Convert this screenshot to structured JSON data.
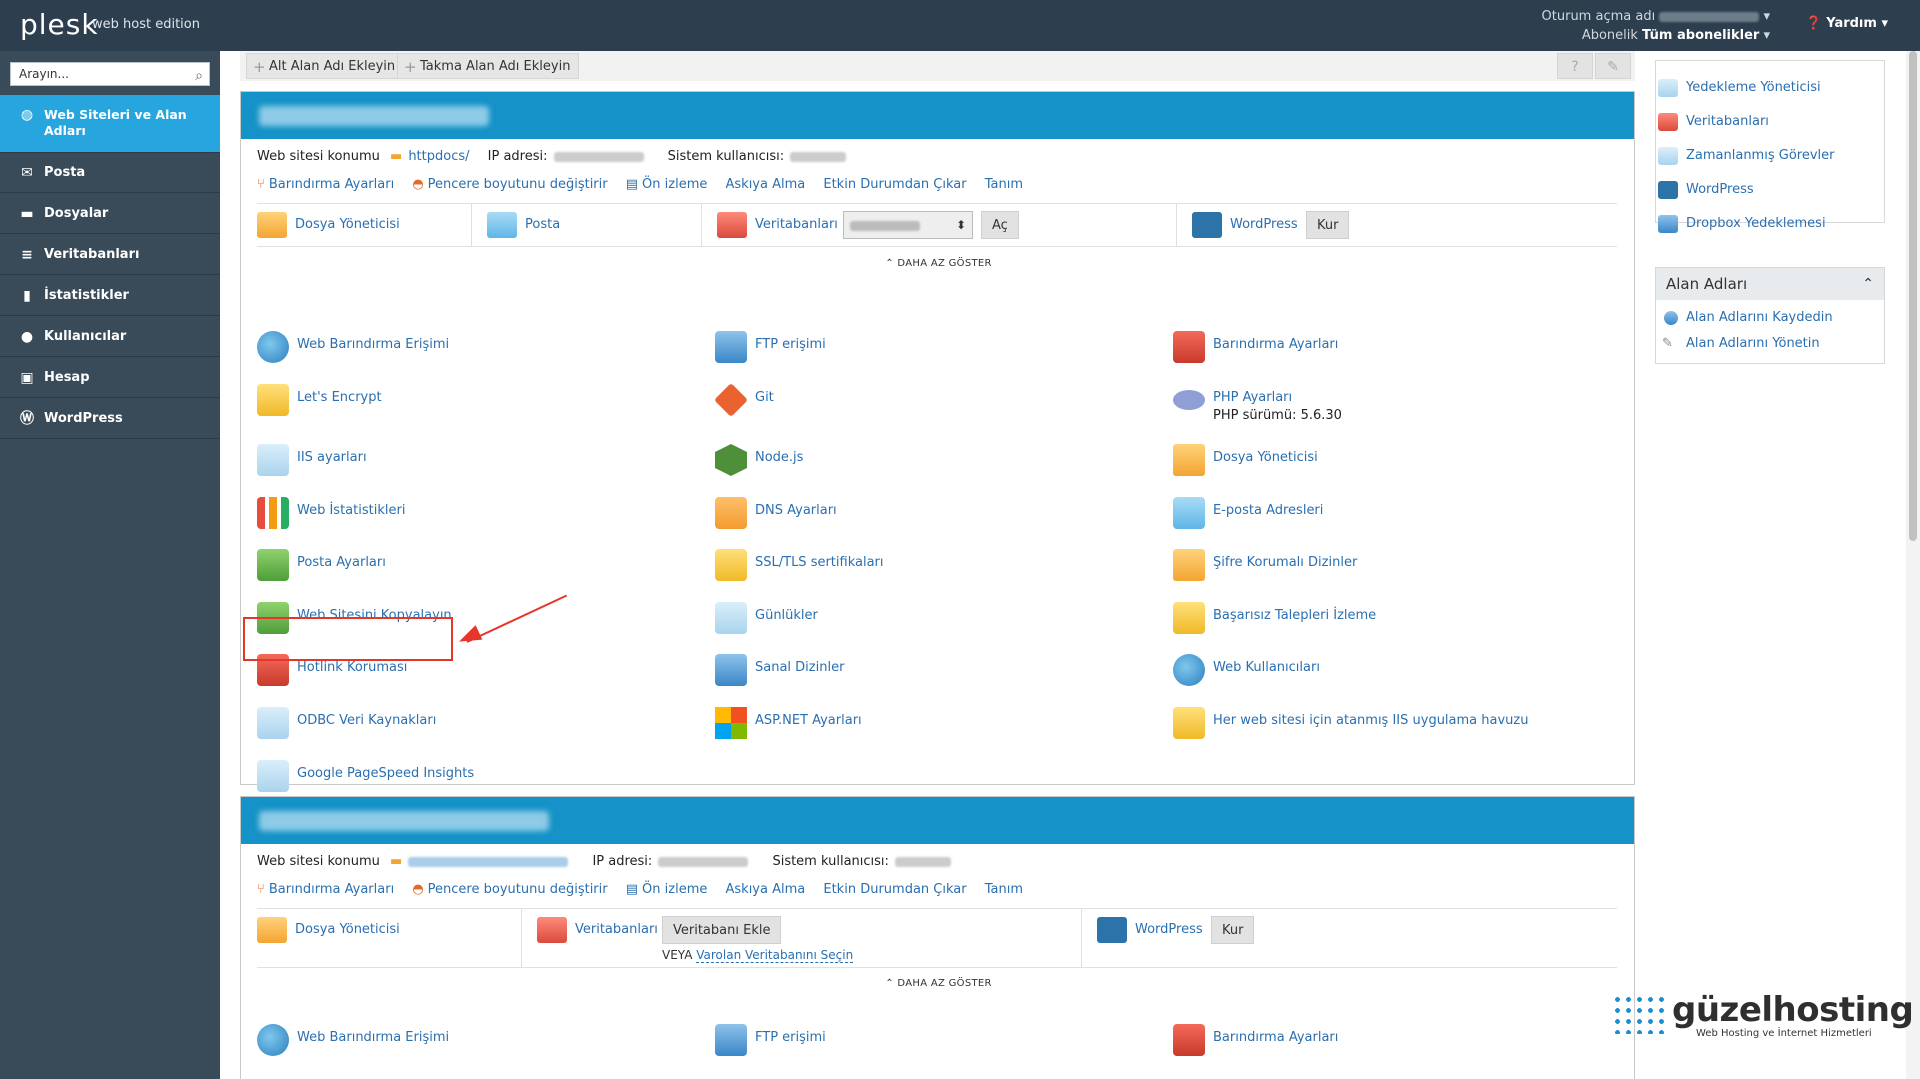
{
  "header": {
    "logo": "plesk",
    "edition": "web host edition",
    "login_label": "Oturum açma adı",
    "subscription_label": "Abonelik",
    "subscription_value": "Tüm abonelikler",
    "help": "Yardım"
  },
  "sidebar": {
    "search_placeholder": "Arayın...",
    "items": [
      {
        "label": "Web Siteleri ve Alan Adları",
        "icon": "globe-icon"
      },
      {
        "label": "Posta",
        "icon": "mail-icon"
      },
      {
        "label": "Dosyalar",
        "icon": "folder-icon"
      },
      {
        "label": "Veritabanları",
        "icon": "database-icon"
      },
      {
        "label": "İstatistikler",
        "icon": "stats-icon"
      },
      {
        "label": "Kullanıcılar",
        "icon": "user-icon"
      },
      {
        "label": "Hesap",
        "icon": "account-icon"
      },
      {
        "label": "WordPress",
        "icon": "wordpress-icon"
      }
    ]
  },
  "toolbar": {
    "add_subdomain": "Alt Alan Adı Ekleyin",
    "add_alias": "Takma Alan Adı Ekleyin"
  },
  "sub1": {
    "site_location_label": "Web sitesi konumu",
    "site_location_value": "httpdocs/",
    "ip_label": "IP adresi:",
    "sysuser_label": "Sistem kullanıcısı:",
    "links": [
      "Barındırma Ayarları",
      "Pencere boyutunu değiştirir",
      "Ön izleme",
      "Askıya Alma",
      "Etkin Durumdan Çıkar",
      "Tanım"
    ],
    "quick": {
      "file_manager": "Dosya Yöneticisi",
      "mail": "Posta",
      "databases": "Veritabanları",
      "open_btn": "Aç",
      "wordpress": "WordPress",
      "install_btn": "Kur"
    },
    "show_less": "DAHA AZ GÖSTER",
    "tools": [
      {
        "label": "Web Barındırma Erişimi",
        "icon": "globe-icon"
      },
      {
        "label": "FTP erişimi",
        "icon": "ftp-icon"
      },
      {
        "label": "Barındırma Ayarları",
        "icon": "hosting-settings-icon"
      },
      {
        "label": "Let's Encrypt",
        "icon": "letsencrypt-icon"
      },
      {
        "label": "Git",
        "icon": "git-icon"
      },
      {
        "label": "PHP Ayarları",
        "icon": "php-icon",
        "sub": "PHP sürümü: 5.6.30"
      },
      {
        "label": "IIS ayarları",
        "icon": "iis-icon"
      },
      {
        "label": "Node.js",
        "icon": "nodejs-icon"
      },
      {
        "label": "Dosya Yöneticisi",
        "icon": "folder-icon"
      },
      {
        "label": "Web İstatistikleri",
        "icon": "stats-icon"
      },
      {
        "label": "DNS Ayarları",
        "icon": "dns-icon"
      },
      {
        "label": "E-posta Adresleri",
        "icon": "mail-icon"
      },
      {
        "label": "Posta Ayarları",
        "icon": "mail-settings-icon"
      },
      {
        "label": "SSL/TLS sertifikaları",
        "icon": "certificate-icon"
      },
      {
        "label": "Şifre Korumalı Dizinler",
        "icon": "protected-folder-icon"
      },
      {
        "label": "Web Sitesini Kopyalayın",
        "icon": "copy-icon"
      },
      {
        "label": "Günlükler",
        "icon": "logs-icon"
      },
      {
        "label": "Başarısız Talepleri İzleme",
        "icon": "failed-requests-icon"
      },
      {
        "label": "Hotlink Koruması",
        "icon": "hotlink-icon"
      },
      {
        "label": "Sanal Dizinler",
        "icon": "virtual-folder-icon"
      },
      {
        "label": "Web Kullanıcıları",
        "icon": "web-users-icon"
      },
      {
        "label": "ODBC Veri Kaynakları",
        "icon": "odbc-icon"
      },
      {
        "label": "ASP.NET Ayarları",
        "icon": "aspnet-icon"
      },
      {
        "label": "Her web sitesi için atanmış IIS uygulama havuzu",
        "icon": "app-pool-icon"
      },
      {
        "label": "Google PageSpeed Insights",
        "icon": "pagespeed-icon"
      }
    ]
  },
  "sub2": {
    "site_location_label": "Web sitesi konumu",
    "ip_label": "IP adresi:",
    "sysuser_label": "Sistem kullanıcısı:",
    "links": [
      "Barındırma Ayarları",
      "Pencere boyutunu değiştirir",
      "Ön izleme",
      "Askıya Alma",
      "Etkin Durumdan Çıkar",
      "Tanım"
    ],
    "quick": {
      "file_manager": "Dosya Yöneticisi",
      "databases": "Veritabanları",
      "add_db_btn": "Veritabanı Ekle",
      "or_label": "VEYA",
      "select_db_link": "Varolan Veritabanını Seçin",
      "wordpress": "WordPress",
      "install_btn": "Kur"
    },
    "show_less": "DAHA AZ GÖSTER",
    "tools": [
      {
        "label": "Web Barındırma Erişimi"
      },
      {
        "label": "FTP erişimi"
      },
      {
        "label": "Barındırma Ayarları"
      }
    ]
  },
  "right_panel": {
    "items": [
      {
        "label": "Yedekleme Yöneticisi",
        "icon": "backup-icon"
      },
      {
        "label": "Veritabanları",
        "icon": "database-icon"
      },
      {
        "label": "Zamanlanmış Görevler",
        "icon": "calendar-icon"
      },
      {
        "label": "WordPress",
        "icon": "wordpress-icon"
      },
      {
        "label": "Dropbox Yedeklemesi",
        "icon": "dropbox-icon"
      }
    ],
    "domains_title": "Alan Adları",
    "domain_links": [
      {
        "label": "Alan Adlarını Kaydedin",
        "icon": "register-icon"
      },
      {
        "label": "Alan Adlarını Yönetin",
        "icon": "wrench-icon"
      }
    ]
  },
  "watermark": {
    "brand": "güzelhosting",
    "tagline": "Web Hosting ve İnternet Hizmetleri"
  }
}
